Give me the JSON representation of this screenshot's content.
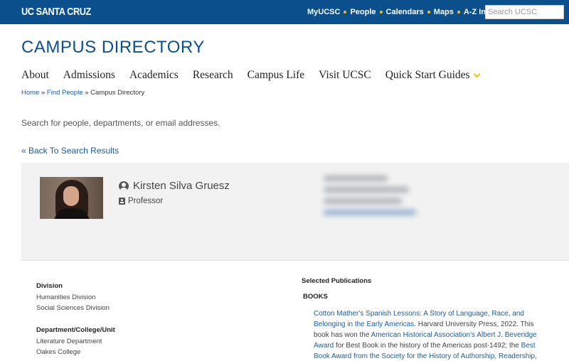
{
  "header": {
    "logo": "UC SANTA CRUZ",
    "links": [
      "MyUCSC",
      "People",
      "Calendars",
      "Maps",
      "A-Z Index"
    ],
    "search_placeholder": "Search UCSC"
  },
  "site_title": "CAMPUS DIRECTORY",
  "nav": [
    "About",
    "Admissions",
    "Academics",
    "Research",
    "Campus Life",
    "Visit UCSC",
    "Quick Start Guides"
  ],
  "breadcrumb": {
    "home": "Home",
    "sep1": " » ",
    "find_people": "Find People",
    "sep2": " » ",
    "current": "Campus Directory"
  },
  "intro": "Search for people, departments, or email addresses.",
  "back_link": "« Back To Search Results",
  "profile": {
    "name": "Kirsten Silva Gruesz",
    "title": "Professor"
  },
  "details": {
    "division_label": "Division",
    "divisions": [
      "Humanities Division",
      "Social Sciences Division"
    ],
    "dept_label": "Department/College/Unit",
    "depts": [
      "Literature Department",
      "Oakes College"
    ]
  },
  "publications": {
    "heading": "Selected Publications",
    "books_label": "BOOKS",
    "book1_link": "Cotton Mather's Spanish Lessons: A Story of Language, Race, and Belonging in the Early Americas.",
    "book1_text1": " Harvard University Press, 2022. This book has won the ",
    "book1_link2": "American Historical Association's Albert J. Beveridge Award",
    "book1_text2": " for Best Book in the history of the Americas post-1492; the ",
    "book1_link3": "Best Book Award from the Society for the History of Authorship, Readership, and"
  },
  "colors": {
    "brand_blue": "#0b4f8c",
    "accent_gold": "#f3c00a",
    "link_blue": "#1a5d9c"
  }
}
